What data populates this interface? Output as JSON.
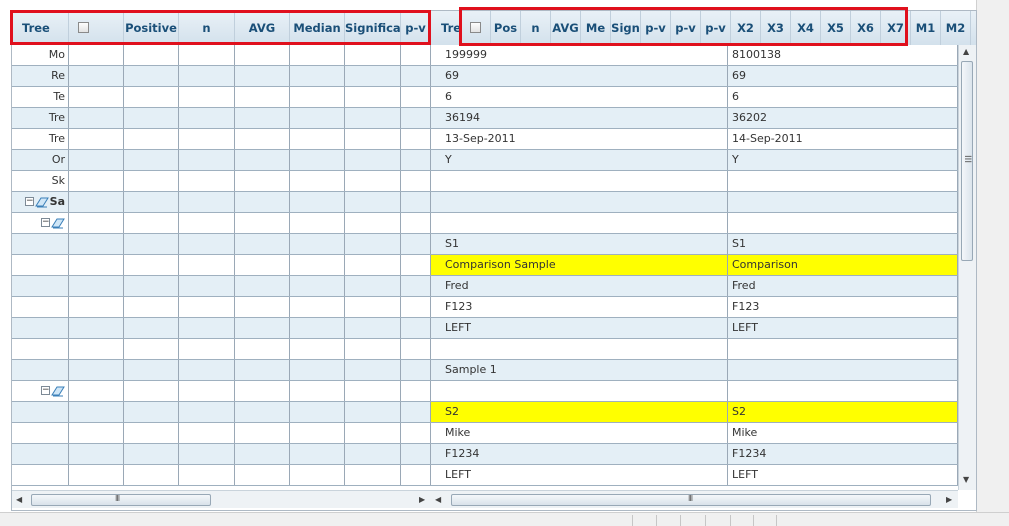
{
  "left_grid": {
    "headers": [
      {
        "key": "tree",
        "label": "Tree"
      },
      {
        "key": "select_all",
        "label": ""
      },
      {
        "key": "positive",
        "label": "Positive"
      },
      {
        "key": "n",
        "label": "n"
      },
      {
        "key": "avg",
        "label": "AVG"
      },
      {
        "key": "median",
        "label": "Median"
      },
      {
        "key": "significance",
        "label": "Significa"
      },
      {
        "key": "pv",
        "label": "p-v"
      }
    ],
    "rows": [
      {
        "tree": "Mo"
      },
      {
        "tree": "Re"
      },
      {
        "tree": "Te"
      },
      {
        "tree": "Tre"
      },
      {
        "tree": "Tre"
      },
      {
        "tree": "Or"
      },
      {
        "tree": "Sk"
      },
      {
        "tree": "Sa",
        "node": "expanded",
        "level": 0
      },
      {
        "tree": "",
        "node": "expanded",
        "level": 1
      },
      {
        "tree": ""
      },
      {
        "tree": ""
      },
      {
        "tree": ""
      },
      {
        "tree": ""
      },
      {
        "tree": ""
      },
      {
        "tree": ""
      },
      {
        "tree": ""
      },
      {
        "tree": "",
        "node": "expanded",
        "level": 1
      },
      {
        "tree": ""
      },
      {
        "tree": ""
      },
      {
        "tree": ""
      },
      {
        "tree": ""
      }
    ]
  },
  "right_grid": {
    "headers": [
      {
        "key": "tree",
        "label": "Tre"
      },
      {
        "key": "select_all",
        "label": ""
      },
      {
        "key": "pos",
        "label": "Pos"
      },
      {
        "key": "n",
        "label": "n"
      },
      {
        "key": "avg",
        "label": "AVG"
      },
      {
        "key": "me",
        "label": "Me"
      },
      {
        "key": "sig",
        "label": "Sign"
      },
      {
        "key": "pv1",
        "label": "p-v"
      },
      {
        "key": "pv2",
        "label": "p-v"
      },
      {
        "key": "pv3",
        "label": "p-v"
      },
      {
        "key": "x2",
        "label": "X2"
      },
      {
        "key": "x3",
        "label": "X3"
      },
      {
        "key": "x4",
        "label": "X4"
      },
      {
        "key": "x5",
        "label": "X5"
      },
      {
        "key": "x6",
        "label": "X6"
      },
      {
        "key": "x7",
        "label": "X7"
      },
      {
        "key": "m1",
        "label": "M1"
      },
      {
        "key": "m2",
        "label": "M2"
      }
    ],
    "rows": [
      {
        "a": "199999",
        "b": "8100138"
      },
      {
        "a": "69",
        "b": "69"
      },
      {
        "a": "6",
        "b": "6"
      },
      {
        "a": "36194",
        "b": "36202"
      },
      {
        "a": "13-Sep-2011",
        "b": "14-Sep-2011"
      },
      {
        "a": "Y",
        "b": "Y"
      },
      {
        "a": "",
        "b": ""
      },
      {
        "a": "",
        "b": ""
      },
      {
        "a": "",
        "b": ""
      },
      {
        "a": "S1",
        "b": "S1"
      },
      {
        "a": "Comparison Sample",
        "b": "Comparison",
        "highlight": true
      },
      {
        "a": "Fred",
        "b": "Fred"
      },
      {
        "a": "F123",
        "b": "F123"
      },
      {
        "a": "LEFT",
        "b": "LEFT"
      },
      {
        "a": "",
        "b": ""
      },
      {
        "a": "Sample 1",
        "b": ""
      },
      {
        "a": "",
        "b": ""
      },
      {
        "a": "S2",
        "b": "S2",
        "highlight": true
      },
      {
        "a": "Mike",
        "b": "Mike"
      },
      {
        "a": "F1234",
        "b": "F1234"
      },
      {
        "a": "LEFT",
        "b": "LEFT"
      }
    ]
  },
  "colors": {
    "highlight": "#ffff00",
    "row_alt": "#e4eff6",
    "header_text": "#1a4f78",
    "annotation": "#e0101d"
  },
  "icons": {
    "expand_collapse": "minus-box-icon",
    "node": "sample-folder-icon",
    "scroll_left": "scroll-left-arrow-icon",
    "scroll_right": "scroll-right-arrow-icon",
    "scroll_up": "scroll-up-arrow-icon",
    "scroll_down": "scroll-down-arrow-icon",
    "grip": "scroll-grip-icon"
  }
}
